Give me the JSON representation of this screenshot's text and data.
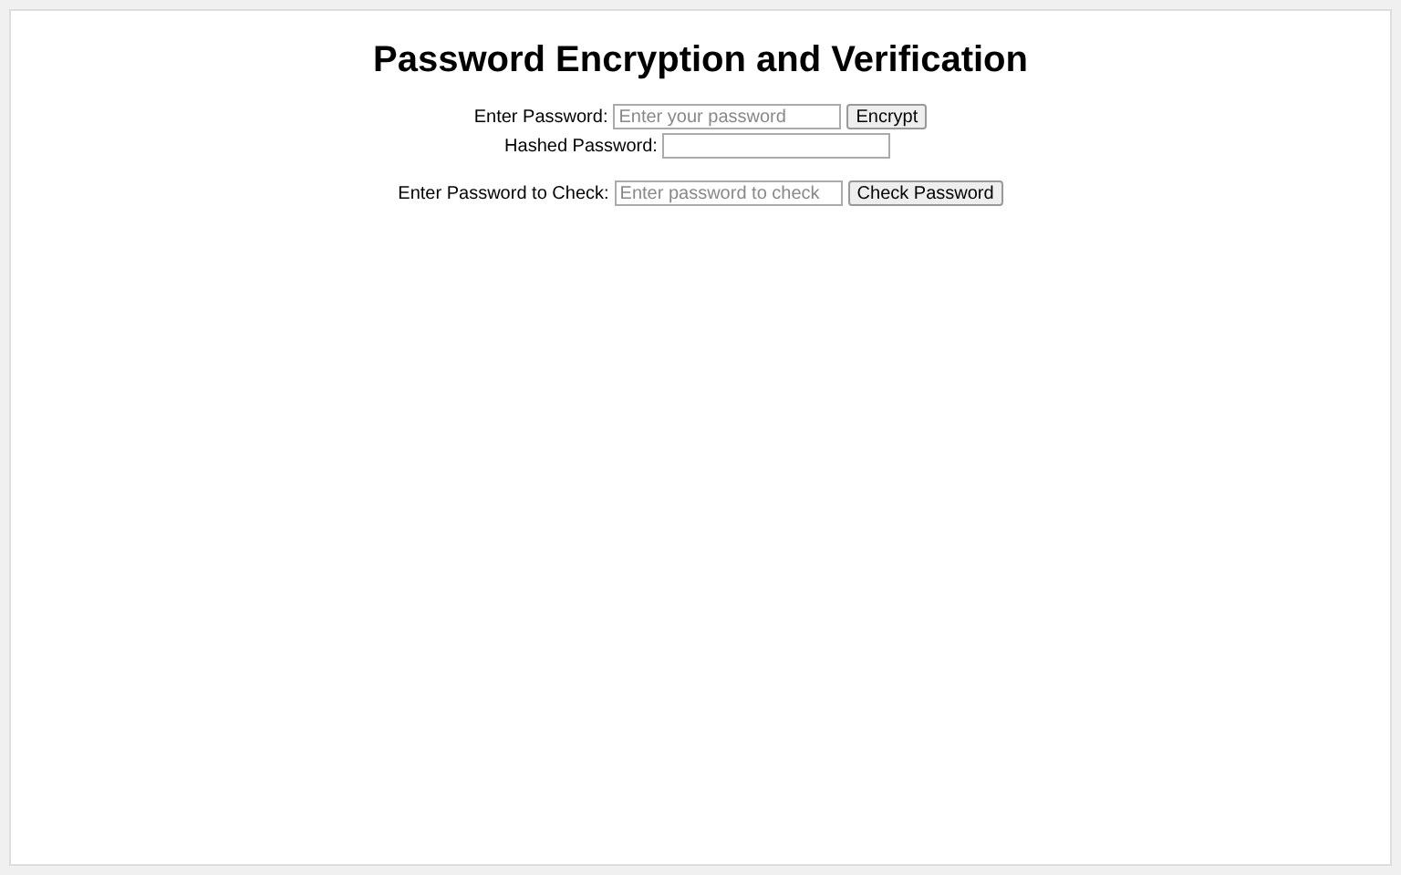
{
  "title": "Password Encryption and Verification",
  "rows": [
    {
      "label": "Enter Password:",
      "field": {
        "placeholder": "Enter your password"
      },
      "button": "Encrypt"
    },
    {
      "label": "Hashed Password:",
      "field": {}
    },
    {
      "label": "Enter Password to Check:",
      "field": {
        "placeholder": "Enter password to check"
      },
      "button": "Check Password"
    }
  ]
}
